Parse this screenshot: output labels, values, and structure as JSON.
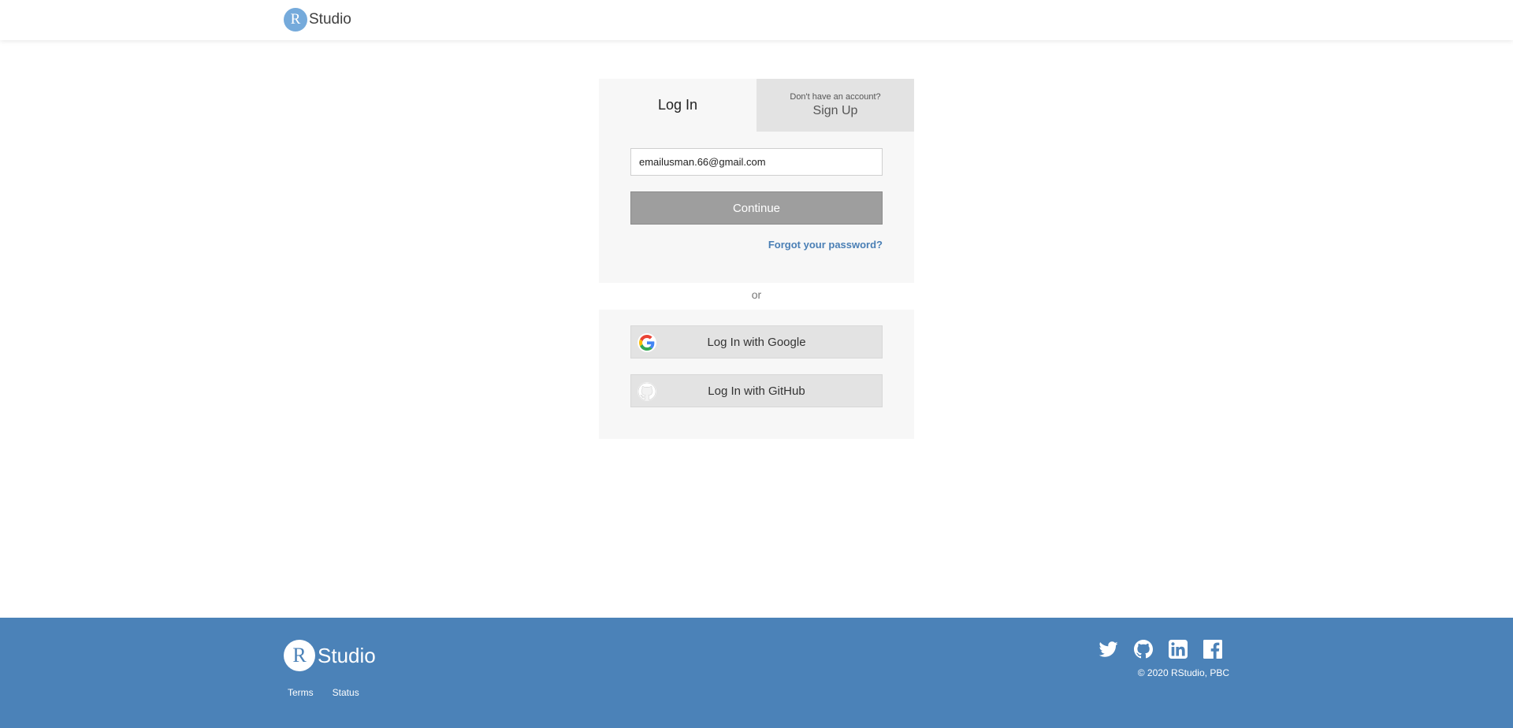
{
  "header": {
    "brand_letter": "R",
    "brand_name": "Studio"
  },
  "login": {
    "tabs": {
      "login_label": "Log In",
      "signup_hint": "Don't have an account?",
      "signup_label": "Sign Up"
    },
    "email_value": "emailusman.66@gmail.com",
    "continue_label": "Continue",
    "forgot_label": "Forgot your password?"
  },
  "divider_text": "or",
  "social_login": {
    "google_label": "Log In with Google",
    "github_label": "Log In with GitHub",
    "google_icon": "google-icon",
    "github_icon": "github-icon"
  },
  "footer": {
    "brand_letter": "R",
    "brand_name": "Studio",
    "links": [
      "Terms",
      "Status"
    ],
    "social_icons": [
      "twitter-icon",
      "github-icon",
      "linkedin-icon",
      "facebook-icon"
    ],
    "copyright": "© 2020 RStudio, PBC"
  },
  "colors": {
    "brand_blue": "#75aadb",
    "footer_blue": "#4b82b8",
    "link_blue": "#4a7fb5",
    "continue_gray": "#9e9e9e"
  }
}
